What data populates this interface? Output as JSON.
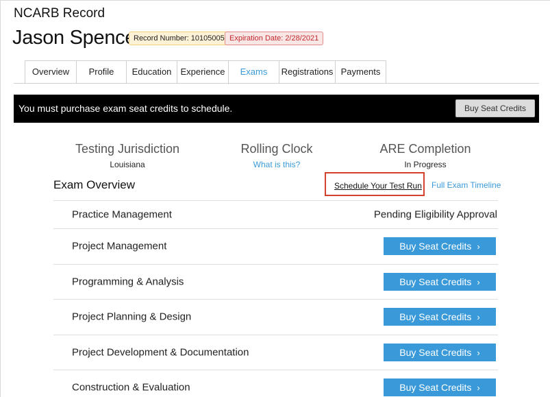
{
  "header": {
    "app_title": "NCARB Record",
    "person_name": "Jason Spencer",
    "record_badge": "Record Number: 10105005",
    "expiration_badge": "Expiration Date: 2/28/2021"
  },
  "tabs": [
    {
      "label": "Overview",
      "active": false
    },
    {
      "label": "Profile",
      "active": false
    },
    {
      "label": "Education",
      "active": false
    },
    {
      "label": "Experience",
      "active": false
    },
    {
      "label": "Exams",
      "active": true
    },
    {
      "label": "Registrations",
      "active": false
    },
    {
      "label": "Payments",
      "active": false
    }
  ],
  "alert": {
    "message": "You must purchase exam seat credits to schedule.",
    "button_label": "Buy Seat Credits"
  },
  "stats": {
    "jurisdiction_title": "Testing Jurisdiction",
    "jurisdiction_value": "Louisiana",
    "clock_title": "Rolling Clock",
    "clock_link": "What is this?",
    "completion_title": "ARE Completion",
    "completion_value": "In Progress"
  },
  "overview": {
    "title": "Exam Overview",
    "schedule_link": "Schedule Your Test Run",
    "timeline_link": "Full Exam Timeline"
  },
  "exams": [
    {
      "name": "Practice Management",
      "status": "Pending Eligibility Approval",
      "button": null
    },
    {
      "name": "Project Management",
      "status": null,
      "button": "Buy Seat Credits"
    },
    {
      "name": "Programming & Analysis",
      "status": null,
      "button": "Buy Seat Credits"
    },
    {
      "name": "Project Planning & Design",
      "status": null,
      "button": "Buy Seat Credits"
    },
    {
      "name": "Project Development & Documentation",
      "status": null,
      "button": "Buy Seat Credits"
    },
    {
      "name": "Construction & Evaluation",
      "status": null,
      "button": "Buy Seat Credits"
    }
  ],
  "icons": {
    "button_chevron": "chevron-right-icon",
    "chevron_glyph": "›"
  },
  "colors": {
    "accent": "#3a9ad9",
    "highlight_border": "#d4402c",
    "alert_bg": "#000000"
  }
}
